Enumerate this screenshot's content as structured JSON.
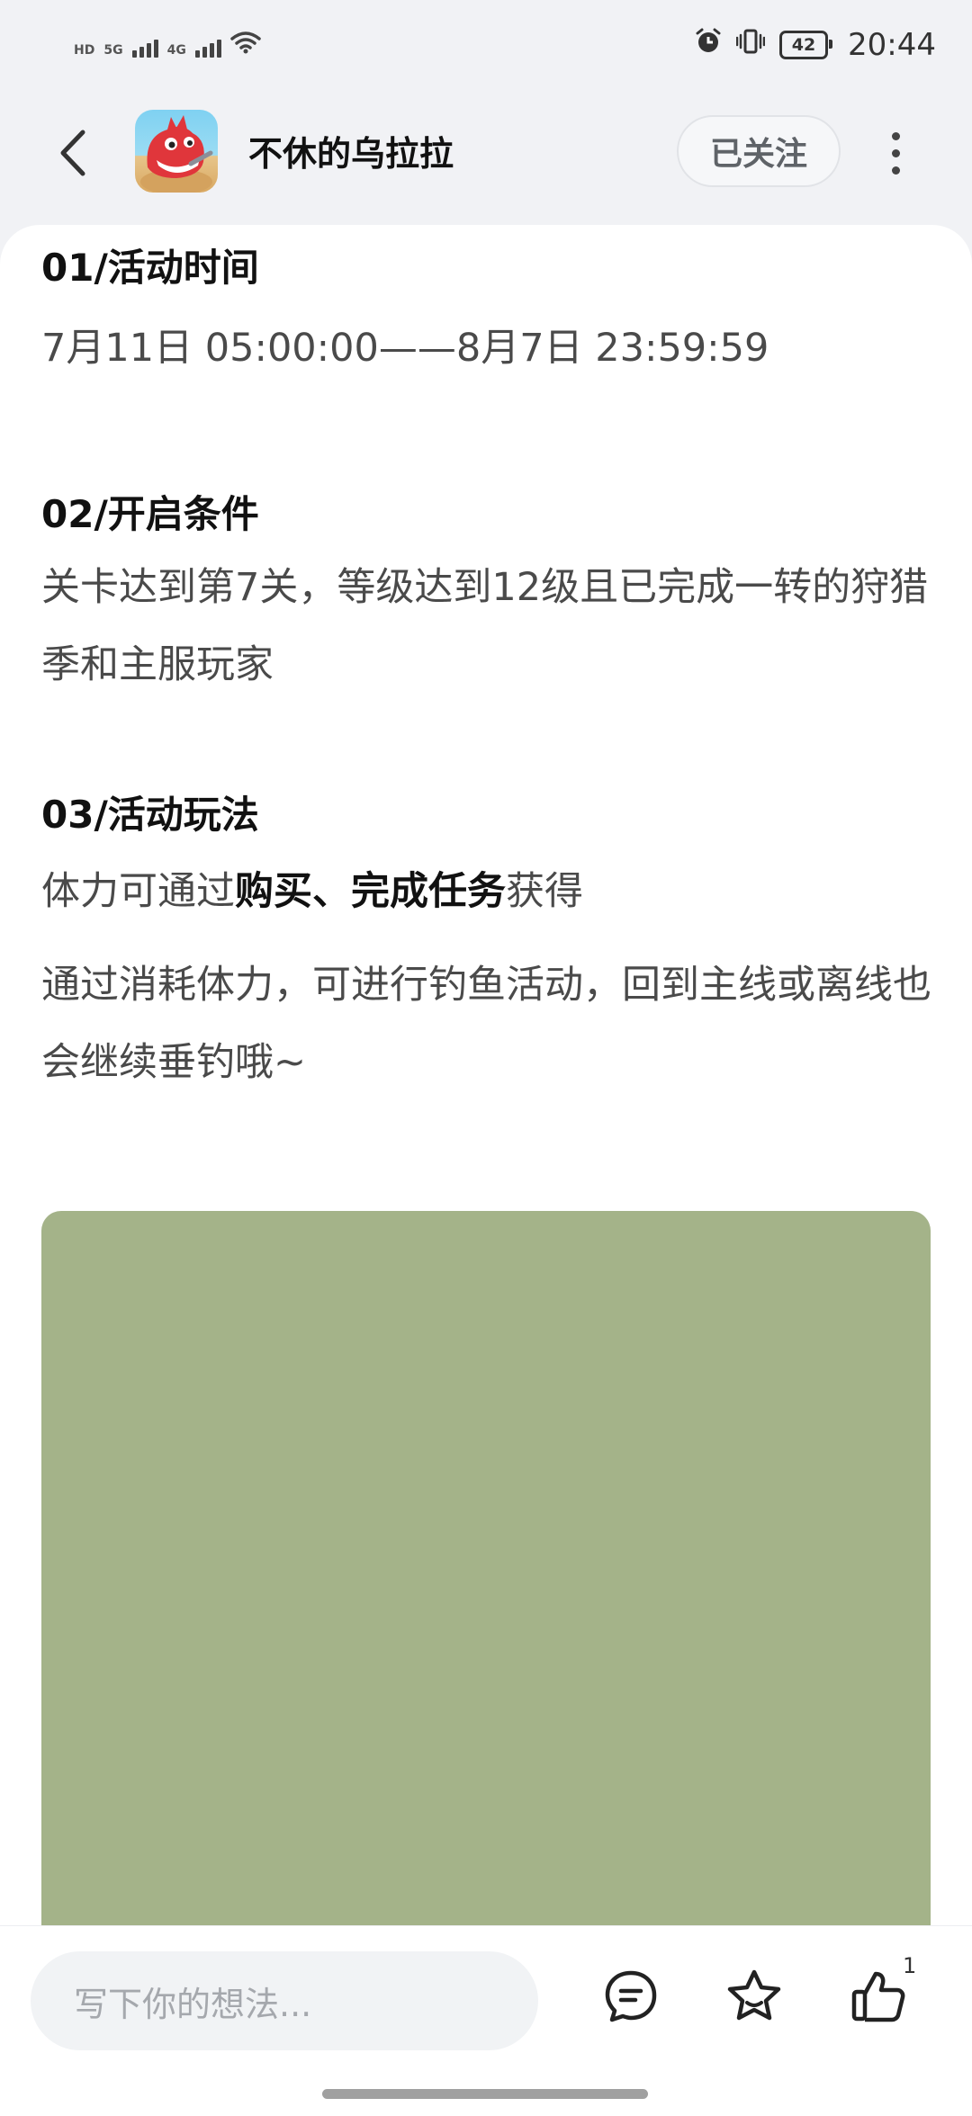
{
  "status": {
    "left_labels": [
      "HD",
      "5G",
      "4G"
    ],
    "time": "20:44",
    "battery": "42"
  },
  "header": {
    "title": "不休的乌拉拉",
    "follow_label": "已关注"
  },
  "article": {
    "section1": {
      "heading": "01/活动时间",
      "text": "7月11日 05:00:00——8月7日 23:59:59"
    },
    "section2": {
      "heading": "02/开启条件",
      "text": "关卡达到第7关，等级达到12级且已完成一转的狩猎季和主服玩家"
    },
    "section3": {
      "heading": "03/活动玩法",
      "line1_pre": "体力可通过",
      "line1_bold": "购买、完成任务",
      "line1_post": "获得",
      "line2": "通过消耗体力，可进行钓鱼活动，回到主线或离线也会继续垂钓哦~"
    }
  },
  "bottom": {
    "comment_placeholder": "写下你的想法...",
    "like_count": "1"
  },
  "colors": {
    "image_placeholder": "#a4b389",
    "background": "#f1f2f5"
  }
}
